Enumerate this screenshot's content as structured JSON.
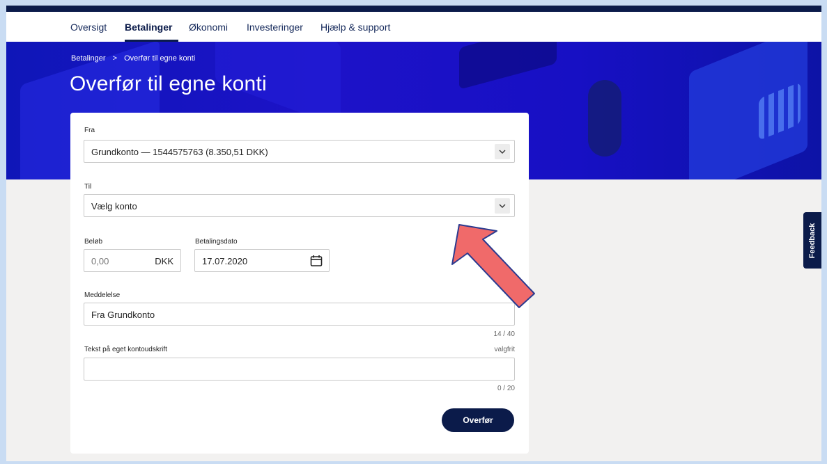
{
  "nav": {
    "items": [
      {
        "label": "Oversigt"
      },
      {
        "label": "Betalinger"
      },
      {
        "label": "Økonomi"
      },
      {
        "label": "Investeringer"
      },
      {
        "label": "Hjælp & support"
      }
    ],
    "active": "Betalinger"
  },
  "breadcrumb": {
    "items": [
      "Betalinger",
      "Overfør til egne konti"
    ],
    "separator": ">"
  },
  "page": {
    "title": "Overfør til egne konti"
  },
  "form": {
    "from": {
      "label": "Fra",
      "value": "Grundkonto — 1544575763 (8.350,51 DKK)"
    },
    "to": {
      "label": "Til",
      "value": "Vælg konto"
    },
    "amount": {
      "label": "Beløb",
      "placeholder": "0,00",
      "currency": "DKK"
    },
    "date": {
      "label": "Betalingsdato",
      "value": "17.07.2020"
    },
    "message": {
      "label": "Meddelelse",
      "value": "Fra Grundkonto",
      "counter": "14 / 40"
    },
    "statement_text": {
      "label": "Tekst på eget kontoudskrift",
      "optional": "valgfrit",
      "value": "",
      "counter": "0 / 20"
    },
    "submit_label": "Overfør"
  },
  "feedback": {
    "label": "Feedback"
  },
  "colors": {
    "navy": "#0b1b4a",
    "hero_blue": "#1710c4",
    "arrow_red": "#f06a6a"
  },
  "icons": {
    "select": "chevron-down-icon",
    "date": "calendar-icon"
  }
}
